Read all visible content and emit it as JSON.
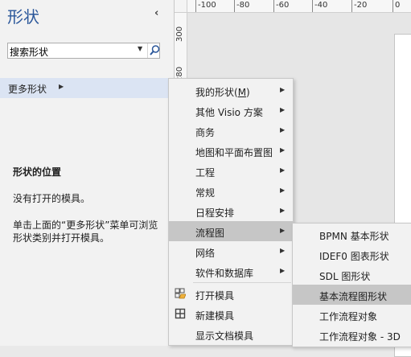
{
  "pane": {
    "title": "形状",
    "collapse_icon": "chevron-left-icon",
    "search": {
      "value": "搜索形状",
      "dropdown_icon": "caret-down-icon",
      "button_icon": "search-icon"
    },
    "more_shapes": {
      "label": "更多形状",
      "arrow_icon": "caret-right-icon"
    },
    "location_title": "形状的位置",
    "no_stencil": "没有打开的模具。",
    "hint": "单击上面的“更多形状”菜单可浏览形状类别并打开模具。"
  },
  "rulers": {
    "top_ticks": [
      "-100",
      "-80",
      "-60",
      "-40",
      "-20",
      "0"
    ],
    "left_ticks": [
      "300",
      "280"
    ]
  },
  "menu": {
    "items": [
      {
        "label": "我的形状(",
        "accel": "M",
        "suffix": ")",
        "has_sub": true
      },
      {
        "label": "其他 Visio 方案",
        "has_sub": true
      },
      {
        "label": "商务",
        "has_sub": true
      },
      {
        "label": "地图和平面布置图",
        "has_sub": true
      },
      {
        "label": "工程",
        "has_sub": true
      },
      {
        "label": "常规",
        "has_sub": true
      },
      {
        "label": "日程安排",
        "has_sub": true
      },
      {
        "label": "流程图",
        "has_sub": true,
        "highlighted": true
      },
      {
        "label": "网络",
        "has_sub": true
      },
      {
        "label": "软件和数据库",
        "has_sub": true
      },
      {
        "label": "打开模具",
        "icon": "open-folder-icon"
      },
      {
        "label": "新建模具",
        "icon": "new-stencil-icon"
      },
      {
        "label": "显示文档模具"
      }
    ]
  },
  "submenu": {
    "items": [
      {
        "label": "BPMN 基本形状"
      },
      {
        "label": "IDEF0 图表形状"
      },
      {
        "label": "SDL 图形状"
      },
      {
        "label": "基本流程图形状",
        "highlighted": true
      },
      {
        "label": "工作流程对象"
      },
      {
        "label": "工作流程对象 - 3D"
      }
    ]
  },
  "colors": {
    "title": "#2b579a",
    "selected_bg": "#dbe4f3",
    "menu_highlight": "#c6c6c6"
  }
}
